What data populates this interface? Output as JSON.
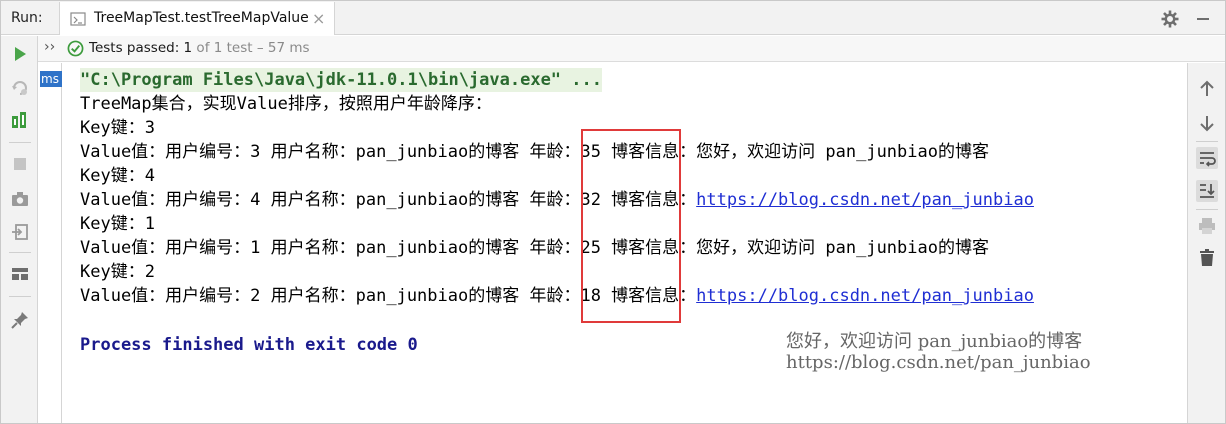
{
  "topbar": {
    "run_label": "Run:",
    "tab_title": "TreeMapTest.testTreeMapValue",
    "tab_close": "×"
  },
  "status": {
    "chevron": "››",
    "passed_label": "Tests passed: ",
    "passed_count": "1",
    "passed_rest": " of 1 test – 57 ms"
  },
  "tree": {
    "badge": "ms"
  },
  "console": {
    "command": "\"C:\\Program Files\\Java\\jdk-11.0.1\\bin\\java.exe\" ...",
    "intro": "TreeMap集合，实现Value排序，按照用户年龄降序：",
    "entries": [
      {
        "key_line": "Key键：3",
        "value_line": "Value值：用户编号：3 用户名称：pan_junbiao的博客 年龄：35 博客信息：您好，欢迎访问 pan_junbiao的博客",
        "link": ""
      },
      {
        "key_line": "Key键：4",
        "value_line": "Value值：用户编号：4 用户名称：pan_junbiao的博客 年龄：32 博客信息：",
        "link": "https://blog.csdn.net/pan_junbiao"
      },
      {
        "key_line": "Key键：1",
        "value_line": "Value值：用户编号：1 用户名称：pan_junbiao的博客 年龄：25 博客信息：您好，欢迎访问 pan_junbiao的博客",
        "link": ""
      },
      {
        "key_line": "Key键：2",
        "value_line": "Value值：用户编号：2 用户名称：pan_junbiao的博客 年龄：18 博客信息：",
        "link": "https://blog.csdn.net/pan_junbiao"
      }
    ],
    "exit": "Process finished with exit code 0"
  },
  "watermark": {
    "line1": "您好，欢迎访问 pan_junbiao的博客",
    "line2": "https://blog.csdn.net/pan_junbiao"
  },
  "colors": {
    "pass_green": "#3c9b3c",
    "run_green": "#4aa54a",
    "link_blue": "#1f2ed3",
    "highlight_red": "#e03a3a"
  },
  "icons": {
    "top": [
      "junit-icon",
      "gear-icon",
      "minimize-icon"
    ],
    "left": [
      "run-icon",
      "rerun-failed-icon",
      "toggle-auto-test-icon",
      "stop-icon",
      "camera-icon",
      "login-icon",
      "layout-icon",
      "pin-icon"
    ],
    "right": [
      "up-arrow-icon",
      "down-arrow-icon",
      "soft-wrap-icon",
      "scroll-to-end-icon",
      "print-icon",
      "trash-icon"
    ]
  }
}
